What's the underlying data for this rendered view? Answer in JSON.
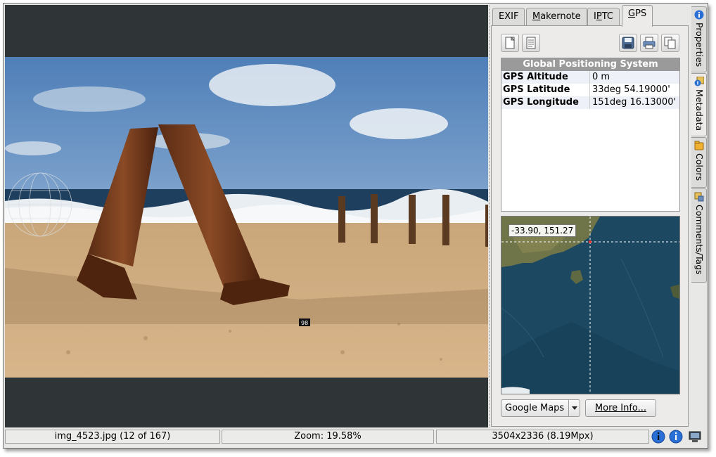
{
  "tabs": [
    {
      "label": "EXIF",
      "mnemonic": ""
    },
    {
      "pre": "",
      "mnemonic": "M",
      "post": "akernote"
    },
    {
      "pre": "I",
      "mnemonic": "P",
      "post": "TC"
    },
    {
      "pre": "",
      "mnemonic": "G",
      "post": "PS"
    }
  ],
  "gps_table": {
    "header": "Global Positioning System",
    "rows": [
      {
        "key": "GPS Altitude",
        "value": "0 m"
      },
      {
        "key": "GPS Latitude",
        "value": "33deg 54.19000'"
      },
      {
        "key": "GPS Longitude",
        "value": "151deg 16.13000'"
      }
    ]
  },
  "map": {
    "coordinates": "-33.90, 151.27",
    "service": "Google Maps",
    "more_info_label": "More Info..."
  },
  "sidebar": {
    "tabs": [
      "Properties",
      "Metadata",
      "Colors",
      "Comments/Tags"
    ]
  },
  "statusbar": {
    "file": "img_4523.jpg (12 of 167)",
    "zoom": "Zoom: 19.58%",
    "size": "3504x2336 (8.19Mpx)"
  },
  "photo": {
    "marker_label": "98"
  },
  "colors": {
    "viewer_bg": "#2f3537",
    "table_header_bg": "#9a9a9a",
    "info_icon_blue": "#2a6fd6"
  },
  "icons": [
    "new-document-icon",
    "edit-document-icon",
    "save-icon",
    "print-icon",
    "copy-icon",
    "info-icon",
    "folder-icon",
    "tag-icon",
    "monitor-icon"
  ]
}
